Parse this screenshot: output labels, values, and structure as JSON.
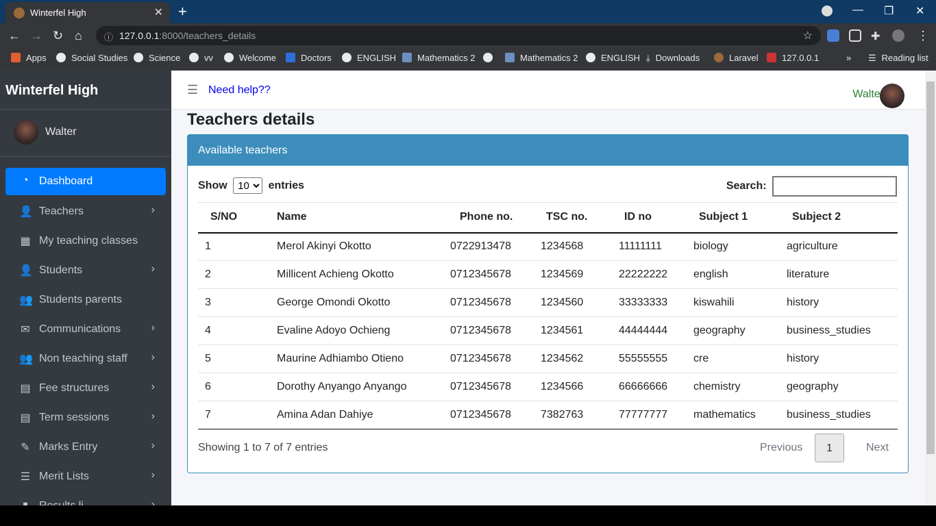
{
  "browser": {
    "tab_title": "Winterfel High",
    "url_host": "127.0.0.1",
    "url_rest": ":8000/teachers_details",
    "bookmarks": [
      "Apps",
      "Social Studies",
      "Science",
      "vv",
      "Welcome",
      "Doctors",
      "ENGLISH",
      "Mathematics 2",
      "",
      "Mathematics 2",
      "ENGLISH",
      "Downloads",
      "Laravel",
      "127.0.0.1",
      "»",
      "Reading list"
    ]
  },
  "sidebar": {
    "brand": "Winterfel High",
    "user": "Walter",
    "items": [
      {
        "label": "Dashboard",
        "icon": "dashboard-icon",
        "active": true,
        "chevron": false
      },
      {
        "label": "Teachers",
        "icon": "user-icon",
        "active": false,
        "chevron": true
      },
      {
        "label": "My teaching classes",
        "icon": "grid-icon",
        "active": false,
        "chevron": false
      },
      {
        "label": "Students",
        "icon": "user-icon",
        "active": false,
        "chevron": true
      },
      {
        "label": "Students parents",
        "icon": "users-icon",
        "active": false,
        "chevron": false
      },
      {
        "label": "Communications",
        "icon": "envelope-icon",
        "active": false,
        "chevron": true
      },
      {
        "label": "Non teaching staff",
        "icon": "users-icon",
        "active": false,
        "chevron": true
      },
      {
        "label": "Fee structures",
        "icon": "table-icon",
        "active": false,
        "chevron": true
      },
      {
        "label": "Term sessions",
        "icon": "table-icon",
        "active": false,
        "chevron": true
      },
      {
        "label": "Marks Entry",
        "icon": "edit-icon",
        "active": false,
        "chevron": true
      },
      {
        "label": "Merit Lists",
        "icon": "list-icon",
        "active": false,
        "chevron": true
      },
      {
        "label": "Results li...",
        "icon": "file-icon",
        "active": false,
        "chevron": true
      }
    ]
  },
  "topnav": {
    "help": "Need help??",
    "user": "Walter"
  },
  "main": {
    "title": "Teachers details",
    "card_title": "Available teachers",
    "show_label": "Show",
    "show_value": "10",
    "entries_label": "entries",
    "search_label": "Search:",
    "columns": [
      "S/NO",
      "Name",
      "Phone no.",
      "TSC no.",
      "ID no",
      "Subject 1",
      "Subject 2"
    ],
    "rows": [
      [
        "1",
        "Merol Akinyi Okotto",
        "0722913478",
        "1234568",
        "11111111",
        "biology",
        "agriculture"
      ],
      [
        "2",
        "Millicent Achieng Okotto",
        "0712345678",
        "1234569",
        "22222222",
        "english",
        "literature"
      ],
      [
        "3",
        "George Omondi Okotto",
        "0712345678",
        "1234560",
        "33333333",
        "kiswahili",
        "history"
      ],
      [
        "4",
        "Evaline Adoyo Ochieng",
        "0712345678",
        "1234561",
        "44444444",
        "geography",
        "business_studies"
      ],
      [
        "5",
        "Maurine Adhiambo Otieno",
        "0712345678",
        "1234562",
        "55555555",
        "cre",
        "history"
      ],
      [
        "6",
        "Dorothy Anyango Anyango",
        "0712345678",
        "1234566",
        "66666666",
        "chemistry",
        "geography"
      ],
      [
        "7",
        "Amina Adan Dahiye",
        "0712345678",
        "7382763",
        "77777777",
        "mathematics",
        "business_studies"
      ]
    ],
    "info": "Showing 1 to 7 of 7 entries",
    "pager": {
      "prev": "Previous",
      "page": "1",
      "next": "Next"
    }
  }
}
